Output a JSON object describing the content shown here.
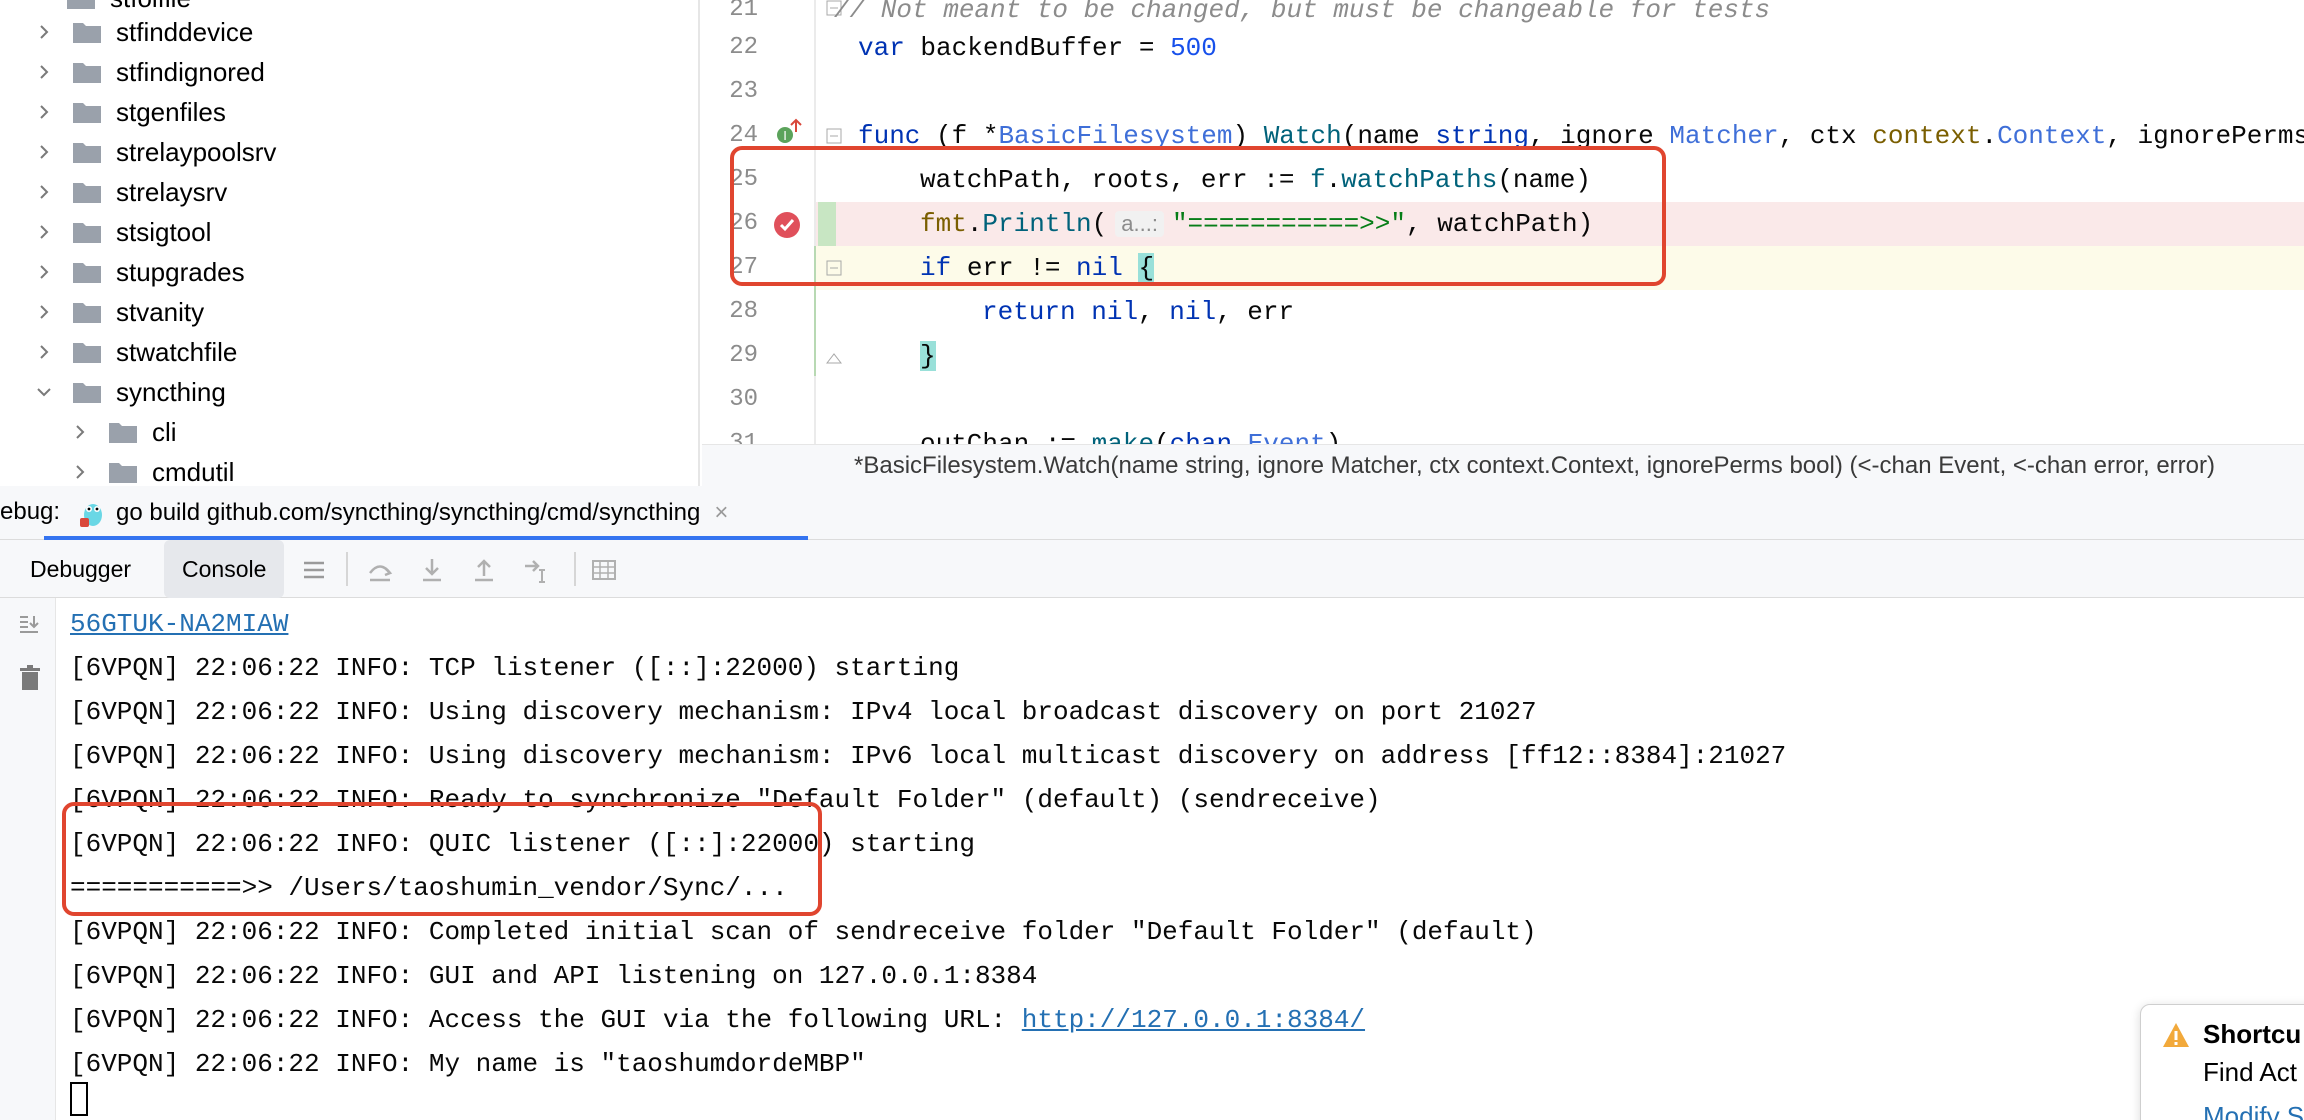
{
  "tree": {
    "partial_top_label": "stfolfile",
    "items": [
      {
        "label": "stfinddevice",
        "expanded": false
      },
      {
        "label": "stfindignored",
        "expanded": false
      },
      {
        "label": "stgenfiles",
        "expanded": false
      },
      {
        "label": "strelaypoolsrv",
        "expanded": false
      },
      {
        "label": "strelaysrv",
        "expanded": false
      },
      {
        "label": "stsigtool",
        "expanded": false
      },
      {
        "label": "stupgrades",
        "expanded": false
      },
      {
        "label": "stvanity",
        "expanded": false
      },
      {
        "label": "stwatchfile",
        "expanded": false
      },
      {
        "label": "syncthing",
        "expanded": true
      },
      {
        "label": "cli",
        "expanded": false
      },
      {
        "label": "cmdutil",
        "expanded": false
      }
    ]
  },
  "editor": {
    "lines": [
      {
        "num": "21",
        "text": "// Not meant to be changed, but must be changeable for tests"
      },
      {
        "num": "22",
        "kw": "var",
        "rest": " backendBuffer = ",
        "value": "500"
      },
      {
        "num": "23"
      },
      {
        "num": "24",
        "kw": "func",
        "p1": " (f *",
        "recv_type": "BasicFilesystem",
        "p2": ") ",
        "fn": "Watch",
        "p3": "(name ",
        "t1": "string",
        "p4": ", ignore ",
        "t2": "Matcher",
        "p5": ", ctx ",
        "ctx_pkg": "context",
        "dot": ".",
        "t3": "Context",
        "p6": ", ignorePerms "
      },
      {
        "num": "25",
        "lhs": "watchPath, roots, err := ",
        "recv": "f",
        "dot": ".",
        "fn": "watchPaths",
        "args": "(name)"
      },
      {
        "num": "26",
        "pkg": "fmt",
        "dot": ".",
        "fn": "Println",
        "open": "(",
        "hint": "a...:",
        "str": "\"===========>>\"",
        "rest": ", watchPath)"
      },
      {
        "num": "27",
        "kw1": "if",
        "mid": " err != ",
        "kw2": "nil",
        "brace": "{"
      },
      {
        "num": "28",
        "kw1": "return",
        "sp": " ",
        "kw2": "nil",
        "c1": ", ",
        "kw3": "nil",
        "c2": ", err"
      },
      {
        "num": "29",
        "brace": "}"
      },
      {
        "num": "30"
      },
      {
        "num": "31",
        "lhs": "outChan := ",
        "fn": "make",
        "open": "(",
        "kw": "chan",
        "sp": " ",
        "typ": "Event",
        "close": ")"
      }
    ],
    "signature": "*BasicFilesystem.Watch(name string, ignore Matcher, ctx context.Context, ignorePerms bool) (<-chan Event, <-chan error, error)"
  },
  "run_panel": {
    "label": "ebug:",
    "tab_title": "go build github.com/syncthing/syncthing/cmd/syncthing",
    "close": "×",
    "tabs": [
      "Debugger",
      "Console"
    ]
  },
  "console": {
    "lines": [
      {
        "text": "",
        "link": "56GTUK-NA2MIAW"
      },
      {
        "text": "[6VPQN] 22:06:22 INFO: TCP listener ([::]:22000) starting"
      },
      {
        "text": "[6VPQN] 22:06:22 INFO: Using discovery mechanism: IPv4 local broadcast discovery on port 21027"
      },
      {
        "text": "[6VPQN] 22:06:22 INFO: Using discovery mechanism: IPv6 local multicast discovery on address [ff12::8384]:21027"
      },
      {
        "text": "[6VPQN] 22:06:22 INFO: Ready to synchronize \"Default Folder\" (default) (sendreceive)"
      },
      {
        "text": "[6VPQN] 22:06:22 INFO: QUIC listener ([::]:22000) starting"
      },
      {
        "text": "===========>> /Users/taoshumin_vendor/Sync/..."
      },
      {
        "text": "[6VPQN] 22:06:22 INFO: Completed initial scan of sendreceive folder \"Default Folder\" (default)"
      },
      {
        "text": "[6VPQN] 22:06:22 INFO: GUI and API listening on 127.0.0.1:8384"
      },
      {
        "text": "[6VPQN] 22:06:22 INFO: Access the GUI via the following URL: ",
        "link": "http://127.0.0.1:8384/"
      },
      {
        "text": "[6VPQN] 22:06:22 INFO: My name is \"taoshumdordeMBP\""
      }
    ]
  },
  "notification": {
    "title": "Shortcu",
    "body": "Find Act",
    "link": "Modify S"
  },
  "colors": {
    "annotation": "#e0452f",
    "breakpoint": "#e0505b",
    "accent": "#3574f0"
  }
}
